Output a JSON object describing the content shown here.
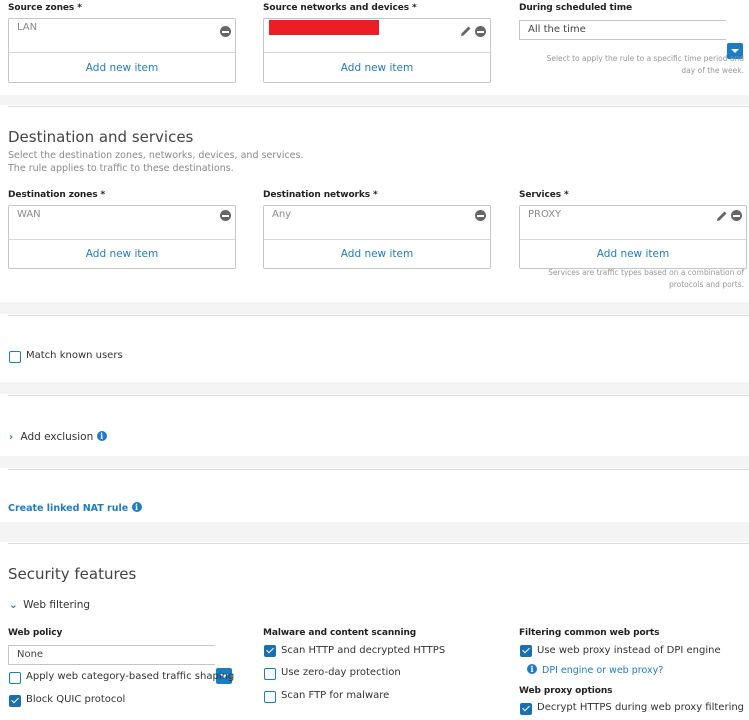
{
  "source": {
    "zones_label": "Source zones *",
    "zones_value": "LAN",
    "zones_add": "Add new item",
    "networks_label": "Source networks and devices *",
    "networks_add": "Add new item",
    "schedule_label": "During scheduled time",
    "schedule_value": "All the time",
    "schedule_help_1": "Select to apply the rule to a specific time period and",
    "schedule_help_2": "day of the week."
  },
  "destination": {
    "title": "Destination and services",
    "desc_1": "Select the destination zones, networks, devices, and services.",
    "desc_2": "The rule applies to traffic to these destinations.",
    "zones_label": "Destination zones *",
    "zones_value": "WAN",
    "zones_add": "Add new item",
    "networks_label": "Destination networks *",
    "networks_value": "Any",
    "networks_add": "Add new item",
    "services_label": "Services *",
    "services_value": "PROXY",
    "services_add": "Add new item",
    "services_help_1": "Services are traffic types based on a combination of",
    "services_help_2": "protocols and ports."
  },
  "match_users": {
    "label": "Match known users",
    "checked": false
  },
  "exclusion": {
    "label": "Add exclusion"
  },
  "nat": {
    "label": "Create linked NAT rule"
  },
  "security": {
    "title": "Security features",
    "web_filtering": "Web filtering",
    "web_policy_label": "Web policy",
    "web_policy_value": "None",
    "apply_shaping": "Apply web category-based traffic shaping",
    "block_quic": "Block QUIC protocol",
    "malware_label": "Malware and content scanning",
    "scan_http": "Scan HTTP and decrypted HTTPS",
    "zero_day": "Use zero-day protection",
    "scan_ftp": "Scan FTP for malware",
    "ports_label": "Filtering common web ports",
    "use_proxy": "Use web proxy instead of DPI engine",
    "dpi_link": "DPI engine or web proxy?",
    "proxy_options_label": "Web proxy options",
    "decrypt_https": "Decrypt HTTPS during web proxy filtering"
  },
  "colors": {
    "accent": "#1a7cc4",
    "redaction": "#ee1c25"
  }
}
